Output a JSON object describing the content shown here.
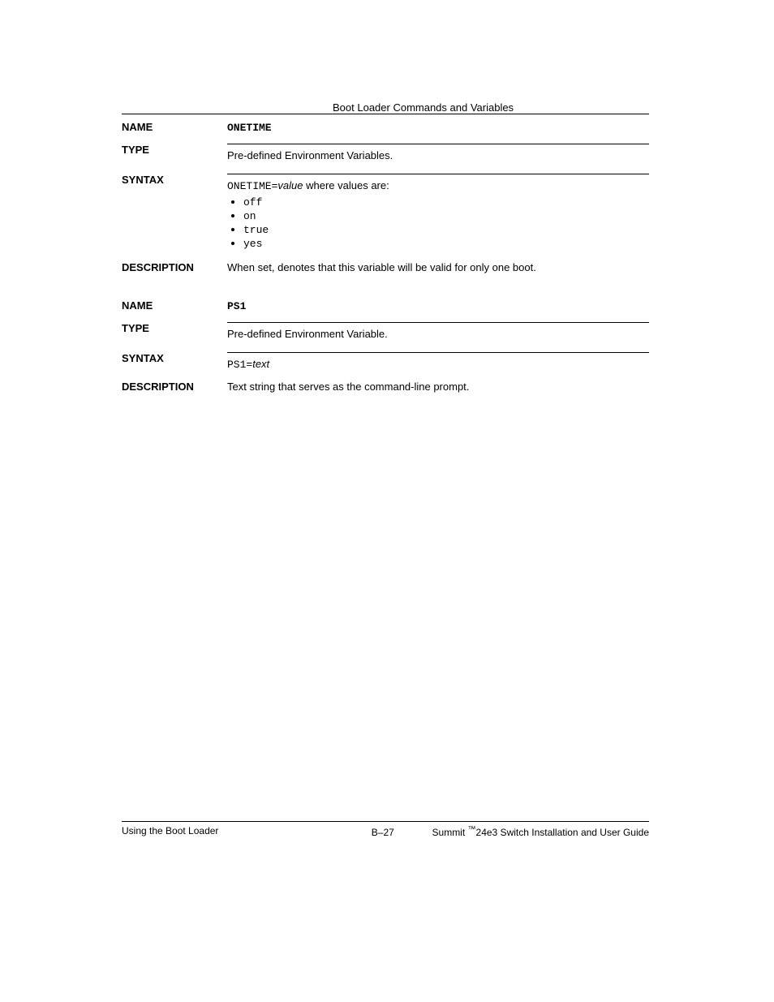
{
  "header": {
    "heading_right": "Boot Loader Commands and Variables"
  },
  "entry1": {
    "name_label": "NAME",
    "name_value": "ONETIME",
    "type_label": "TYPE",
    "type_value": "Pre-defined Environment Variables.",
    "syntax_label": "SYNTAX",
    "syntax_value": "ONETIME=",
    "syntax_args": "value",
    "syntax_text": " where values are:",
    "args": [
      "off",
      "on",
      "true",
      "yes"
    ],
    "desc_label": "DESCRIPTION",
    "desc_value": "When set, denotes that this variable will be valid for only one boot."
  },
  "entry2": {
    "name_label": "NAME",
    "name_value": "PS1",
    "type_label": "TYPE",
    "type_value": "Pre-defined Environment Variable.",
    "syntax_label": "SYNTAX",
    "syntax_value": "PS1=",
    "syntax_args": "text",
    "desc_label": "DESCRIPTION",
    "desc_value": "Text string that serves as the command-line prompt."
  },
  "footer": {
    "left": "Using the Boot Loader",
    "center_prefix": "B",
    "center_sep": "–",
    "center_page": "27",
    "right_product": "Summit ",
    "right_sup": "™",
    "right_rest": "24e3 Switch Installation and User Guide"
  }
}
